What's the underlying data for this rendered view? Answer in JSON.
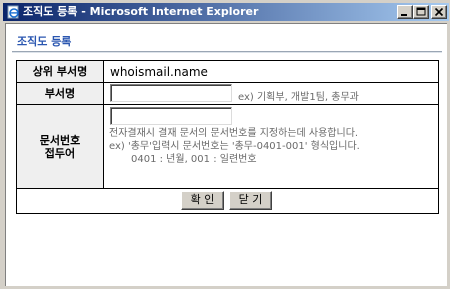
{
  "window": {
    "title": "조직도 등록 - Microsoft Internet Explorer"
  },
  "page": {
    "title": "조직도 등록"
  },
  "form": {
    "parent_label": "상위 부서명",
    "parent_value": "whoismail.name",
    "dept_label": "부서명",
    "dept_value": "",
    "dept_hint": "ex) 기획부, 개발1팀, 총무과",
    "prefix_label_line1": "문서번호",
    "prefix_label_line2": "접두어",
    "prefix_value": "",
    "prefix_desc_line1": "전자결재시 결재 문서의 문서번호를 지정하는데 사용합니다.",
    "prefix_desc_line2": "ex) '총무'입력시 문서번호는 '총무-0401-001' 형식입니다.",
    "prefix_desc_line3": "0401 : 년월, 001 : 일련번호"
  },
  "buttons": {
    "ok": "확 인",
    "close": "닫 기"
  },
  "icons": {
    "app": "ie-page-icon",
    "minimize": "minimize-icon",
    "maximize": "maximize-icon",
    "close": "close-icon"
  }
}
